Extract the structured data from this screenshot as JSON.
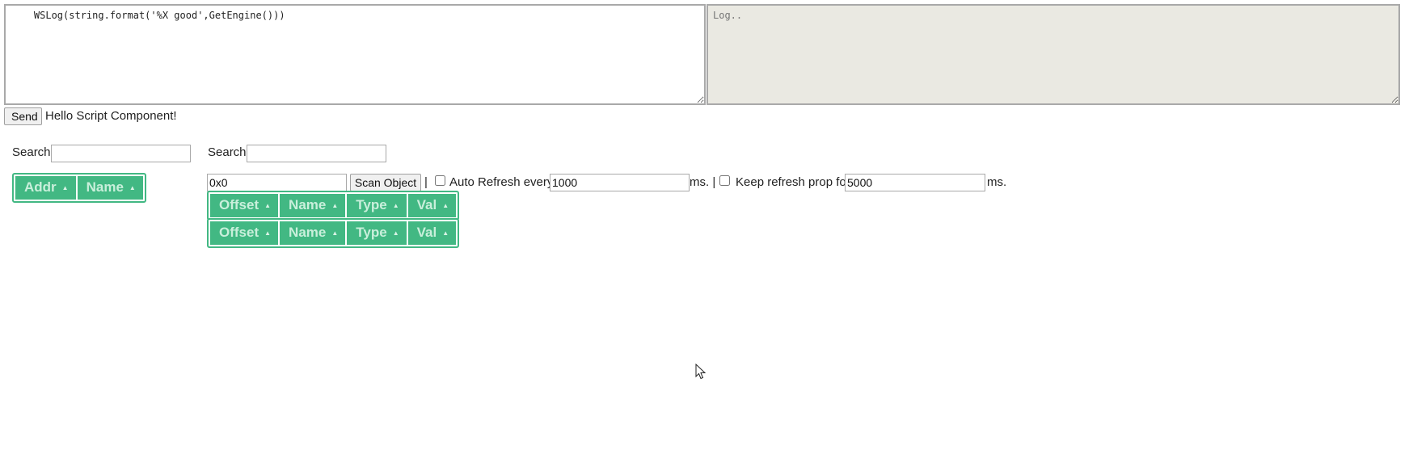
{
  "editor": {
    "script_value": "    WSLog(string.format('%X good',GetEngine()))",
    "log_placeholder": "Log.."
  },
  "send_row": {
    "send_label": "Send",
    "status_text": "Hello Script Component!"
  },
  "left_panel": {
    "search_label": "Search",
    "search_value": "",
    "table": {
      "columns": [
        {
          "label": "Addr",
          "sort_icon": "sort-asc-icon"
        },
        {
          "label": "Name",
          "sort_icon": "sort-asc-icon"
        }
      ]
    }
  },
  "right_panel": {
    "search_label": "Search",
    "search_value": "",
    "address_value": "0x0",
    "scan_label": "Scan Object",
    "separator": "|",
    "auto_refresh": {
      "checked": false,
      "label": "Auto Refresh every",
      "value": "1000",
      "unit": "ms. |"
    },
    "keep_refresh": {
      "checked": false,
      "label": "Keep refresh prop for",
      "value": "5000",
      "unit": "ms."
    },
    "tables": [
      {
        "columns": [
          {
            "label": "Offset",
            "sort_icon": "sort-asc-icon"
          },
          {
            "label": "Name",
            "sort_icon": "sort-asc-icon"
          },
          {
            "label": "Type",
            "sort_icon": "sort-asc-icon"
          },
          {
            "label": "Val",
            "sort_icon": "sort-asc-icon"
          }
        ]
      },
      {
        "columns": [
          {
            "label": "Offset",
            "sort_icon": "sort-asc-icon"
          },
          {
            "label": "Name",
            "sort_icon": "sort-asc-icon"
          },
          {
            "label": "Type",
            "sort_icon": "sort-asc-icon"
          },
          {
            "label": "Val",
            "sort_icon": "sort-asc-icon"
          }
        ]
      }
    ]
  },
  "theme": {
    "accent": "#42b883",
    "header_text": "#c9efdb",
    "log_background": "#eae9e2"
  },
  "glyphs": {
    "sort_asc": "▲"
  }
}
